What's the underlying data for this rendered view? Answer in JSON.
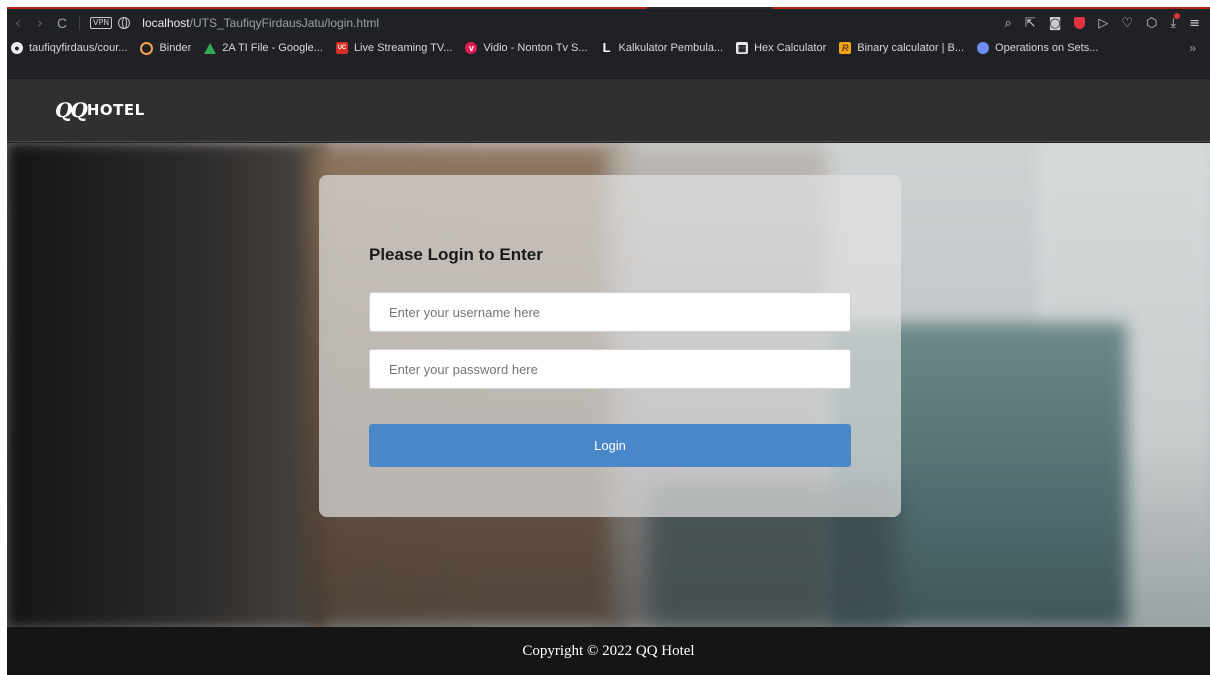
{
  "browser": {
    "url_host": "localhost",
    "url_path": "/UTS_TaufiqyFirdausJatu/login.html",
    "vpn_label": "VPN",
    "nav": {
      "back": "‹",
      "forward": "›",
      "reload": "C"
    },
    "toolbar_icons": [
      "search-icon",
      "share-icon",
      "camera-icon",
      "shield-icon",
      "send-icon",
      "heart-icon",
      "cube-icon",
      "download-icon",
      "menu-icon"
    ]
  },
  "bookmarks": [
    {
      "label": "taufiqyfirdaus/cour...",
      "icon": "github-icon"
    },
    {
      "label": "Binder",
      "icon": "binder-icon"
    },
    {
      "label": "2A TI File - Google...",
      "icon": "drive-icon"
    },
    {
      "label": "Live Streaming TV...",
      "icon": "useetv-icon"
    },
    {
      "label": "Vidio - Nonton Tv S...",
      "icon": "vidio-icon"
    },
    {
      "label": "Kalkulator Pembula...",
      "icon": "L-icon"
    },
    {
      "label": "Hex Calculator",
      "icon": "calculator-icon"
    },
    {
      "label": "Binary calculator | B...",
      "icon": "R-icon"
    },
    {
      "label": "Operations on Sets...",
      "icon": "sets-icon"
    }
  ],
  "bookmarks_more": "»",
  "site": {
    "logo_mark": "QQ",
    "logo_text": "HOTEL"
  },
  "login": {
    "title": "Please Login to Enter",
    "username_placeholder": "Enter your username here",
    "username_value": "",
    "password_placeholder": "Enter your password here",
    "password_value": "",
    "button_label": "Login"
  },
  "footer": {
    "text": "Copyright © 2022 QQ Hotel"
  },
  "colors": {
    "header_bg": "#303030",
    "footer_bg": "#151515",
    "button_bg": "#4a87c9"
  }
}
